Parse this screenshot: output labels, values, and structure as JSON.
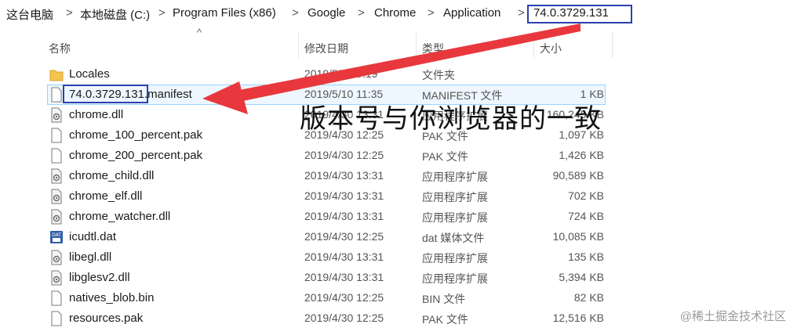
{
  "breadcrumb": {
    "items": [
      "这台电脑",
      "本地磁盘 (C:)",
      "Program Files (x86)",
      "Google",
      "Chrome",
      "Application",
      "74.0.3729.131"
    ],
    "separator": ">"
  },
  "columns": {
    "name": "名称",
    "date": "修改日期",
    "type": "类型",
    "size": "大小"
  },
  "files": [
    {
      "icon": "folder-icon",
      "name": "Locales",
      "date": "2019/5/9 19:19",
      "type": "文件夹",
      "size": ""
    },
    {
      "icon": "file-icon",
      "name_version": "74.0.3729.131",
      "name_suffix": ".manifest",
      "date": "2019/5/10 11:35",
      "type": "MANIFEST 文件",
      "size": "1 KB"
    },
    {
      "icon": "dll-icon",
      "name": "chrome.dll",
      "date": "2019/4/30 13:31",
      "type": "应用程序扩展",
      "size": "160,245 KB"
    },
    {
      "icon": "file-icon",
      "name": "chrome_100_percent.pak",
      "date": "2019/4/30 12:25",
      "type": "PAK 文件",
      "size": "1,097 KB"
    },
    {
      "icon": "file-icon",
      "name": "chrome_200_percent.pak",
      "date": "2019/4/30 12:25",
      "type": "PAK 文件",
      "size": "1,426 KB"
    },
    {
      "icon": "dll-icon",
      "name": "chrome_child.dll",
      "date": "2019/4/30 13:31",
      "type": "应用程序扩展",
      "size": "90,589 KB"
    },
    {
      "icon": "dll-icon",
      "name": "chrome_elf.dll",
      "date": "2019/4/30 13:31",
      "type": "应用程序扩展",
      "size": "702 KB"
    },
    {
      "icon": "dll-icon",
      "name": "chrome_watcher.dll",
      "date": "2019/4/30 13:31",
      "type": "应用程序扩展",
      "size": "724 KB"
    },
    {
      "icon": "dat-icon",
      "name": "icudtl.dat",
      "date": "2019/4/30 12:25",
      "type": "dat 媒体文件",
      "size": "10,085 KB"
    },
    {
      "icon": "dll-icon",
      "name": "libegl.dll",
      "date": "2019/4/30 13:31",
      "type": "应用程序扩展",
      "size": "135 KB"
    },
    {
      "icon": "dll-icon",
      "name": "libglesv2.dll",
      "date": "2019/4/30 13:31",
      "type": "应用程序扩展",
      "size": "5,394 KB"
    },
    {
      "icon": "file-icon",
      "name": "natives_blob.bin",
      "date": "2019/4/30 12:25",
      "type": "BIN 文件",
      "size": "82 KB"
    },
    {
      "icon": "file-icon",
      "name": "resources.pak",
      "date": "2019/4/30 12:25",
      "type": "PAK 文件",
      "size": "12,516 KB"
    }
  ],
  "annotation": {
    "text": "版本号与你浏览器的一致",
    "highlight_color": "#2b3fb0",
    "arrow_color": "#e8383d"
  },
  "watermark": "@稀土掘金技术社区"
}
